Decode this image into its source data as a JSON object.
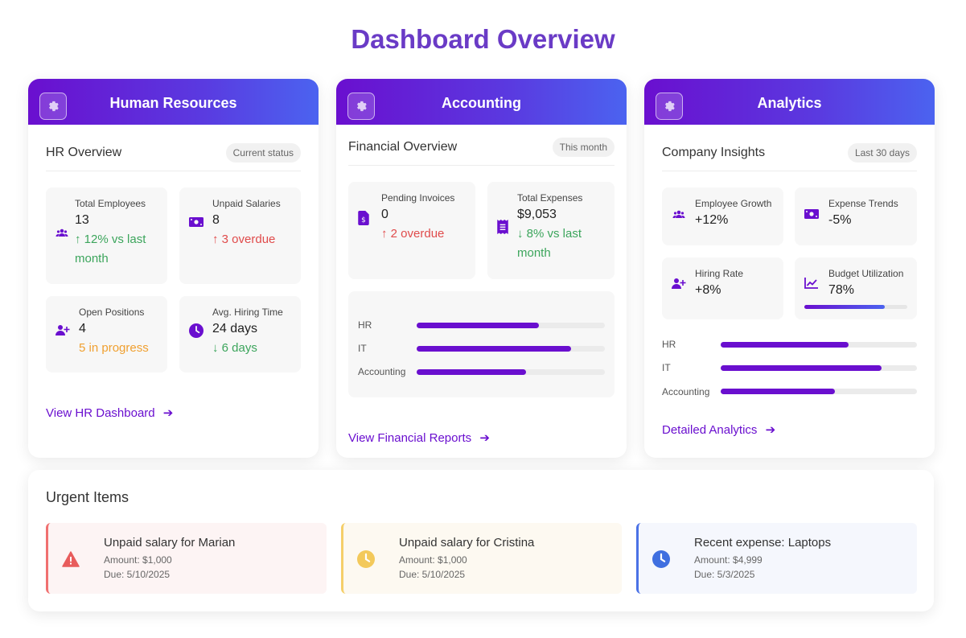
{
  "page": {
    "title": "Dashboard Overview"
  },
  "hr": {
    "title": "Human Resources",
    "section_title": "HR Overview",
    "badge": "Current status",
    "stats": [
      {
        "label": "Total Employees",
        "value": "13",
        "change_line1": "↑ 12% vs last",
        "change_line2": "month",
        "icon": "users-icon"
      },
      {
        "label": "Unpaid Salaries",
        "value": "8",
        "change_line1": "↑ 3 overdue",
        "icon": "money-icon"
      },
      {
        "label": "Open Positions",
        "value": "4",
        "change_line1": "5 in progress",
        "icon": "user-plus-icon"
      },
      {
        "label": "Avg. Hiring Time",
        "value": "24 days",
        "change_line1": "↓ 6 days",
        "icon": "clock-icon"
      }
    ],
    "link": "View HR Dashboard"
  },
  "accounting": {
    "title": "Accounting",
    "section_title": "Financial Overview",
    "badge": "This month",
    "stats": [
      {
        "label": "Pending Invoices",
        "value": "0",
        "change_line1": "↑ 2 overdue",
        "icon": "invoice-icon"
      },
      {
        "label": "Total Expenses",
        "value": "$9,053",
        "change_line1": "↓ 8% vs last",
        "change_line2": "month",
        "icon": "receipt-icon"
      }
    ],
    "bars": [
      {
        "label": "HR",
        "value": 0.65
      },
      {
        "label": "IT",
        "value": 0.82
      },
      {
        "label": "Accounting",
        "value": 0.58
      }
    ],
    "link": "View Financial Reports"
  },
  "analytics": {
    "title": "Analytics",
    "section_title": "Company Insights",
    "badge": "Last 30 days",
    "stats": [
      {
        "label": "Employee Growth",
        "value": "+12%",
        "icon": "users-icon"
      },
      {
        "label": "Expense Trends",
        "value": "-5%",
        "icon": "money-icon"
      },
      {
        "label": "Hiring Rate",
        "value": "+8%",
        "icon": "user-plus-icon"
      },
      {
        "label": "Budget Utilization",
        "value": "78%",
        "progress": 0.78,
        "icon": "chart-line-icon"
      }
    ],
    "bars": [
      {
        "label": "HR",
        "value": 0.65
      },
      {
        "label": "IT",
        "value": 0.82
      },
      {
        "label": "Accounting",
        "value": 0.58
      }
    ],
    "link": "Detailed Analytics"
  },
  "urgent": {
    "title": "Urgent Items",
    "items": [
      {
        "title": "Unpaid salary for Marian",
        "amount": "Amount: $1,000",
        "due": "Due: 5/10/2025",
        "icon": "warning-icon",
        "accent": "#f07070",
        "bg": "#fdf4f4"
      },
      {
        "title": "Unpaid salary for Cristina",
        "amount": "Amount: $1,000",
        "due": "Due: 5/10/2025",
        "icon": "clock-icon",
        "accent": "#f5cf6a",
        "bg": "#fdf9f1"
      },
      {
        "title": "Recent expense: Laptops",
        "amount": "Amount: $4,999",
        "due": "Due: 5/3/2025",
        "icon": "clock-icon",
        "accent": "#4b72e6",
        "bg": "#f5f7fd"
      }
    ]
  },
  "colors": {
    "brand": "#6a0fcf",
    "green": "#3ca55c",
    "red": "#e04b4b",
    "orange": "#f0a030"
  }
}
